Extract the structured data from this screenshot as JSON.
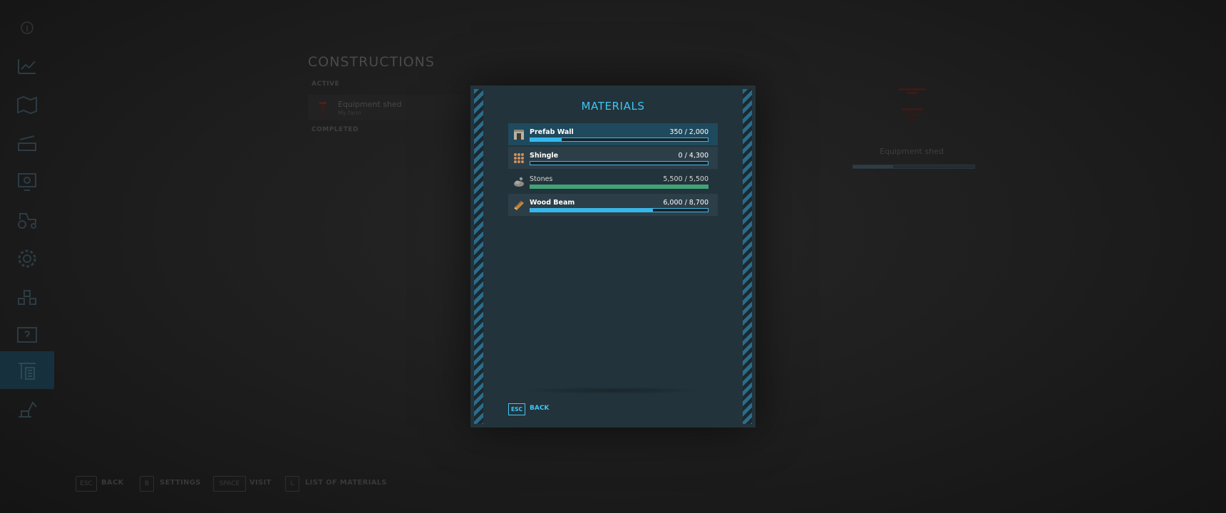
{
  "background": {
    "title": "CONSTRUCTIONS",
    "sections": {
      "active": "ACTIVE",
      "completed": "COMPLETED"
    },
    "active_item": {
      "name": "Equipment shed",
      "owner": "My farm"
    },
    "detail": {
      "name": "Equipment shed",
      "progress_fraction": 0.33
    },
    "footer": [
      {
        "key": "ESC",
        "label": "BACK"
      },
      {
        "key": "B",
        "label": "SETTINGS"
      },
      {
        "key": "SPACE",
        "label": "VISIT"
      },
      {
        "key": "L",
        "label": "LIST OF MATERIALS"
      }
    ],
    "sidebar_icons": [
      "info-icon",
      "stats-icon",
      "map-icon",
      "production-icon",
      "finance-icon",
      "vehicles-icon",
      "settings-icon",
      "animals-icon",
      "help-icon",
      "construction-icon",
      "excavator-icon"
    ],
    "active_sidebar": "construction-icon"
  },
  "dialog": {
    "title": "MATERIALS",
    "materials": [
      {
        "name": "Prefab Wall",
        "value_text": "350 / 2,000",
        "current": 350,
        "required": 2000,
        "icon": "prefab-wall-icon"
      },
      {
        "name": "Shingle",
        "value_text": "0 / 4,300",
        "current": 0,
        "required": 4300,
        "icon": "shingle-icon"
      },
      {
        "name": "Stones",
        "value_text": "5,500 / 5,500",
        "current": 5500,
        "required": 5500,
        "icon": "stones-icon"
      },
      {
        "name": "Wood Beam",
        "value_text": "6,000 / 8,700",
        "current": 6000,
        "required": 8700,
        "icon": "wood-beam-icon"
      }
    ],
    "back": {
      "key": "ESC",
      "label": "BACK"
    }
  },
  "colors": {
    "accent": "#3ec6f4",
    "complete": "#42a277",
    "panel": "#23333b"
  }
}
